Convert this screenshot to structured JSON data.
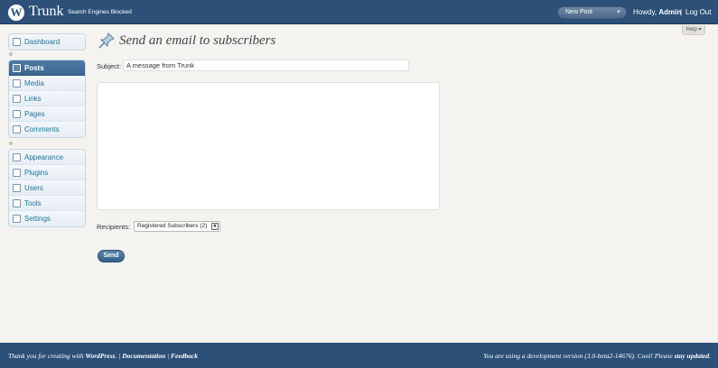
{
  "header": {
    "logo_glyph": "W",
    "site_title": "Trunk",
    "site_subtitle": "Search Engines Blocked",
    "new_post_label": "New Post",
    "new_post_arrow": "▼",
    "howdy_prefix": "Howdy, ",
    "username": "Admin",
    "separator": "|",
    "logout_label": "Log Out",
    "help_label": "Help ▾"
  },
  "sidebar": {
    "group1": [
      {
        "label": "Dashboard",
        "icon": "dashboard-icon"
      }
    ],
    "group2": [
      {
        "label": "Posts",
        "icon": "posts-icon",
        "current": true
      },
      {
        "label": "Media",
        "icon": "media-icon"
      },
      {
        "label": "Links",
        "icon": "links-icon"
      },
      {
        "label": "Pages",
        "icon": "pages-icon"
      },
      {
        "label": "Comments",
        "icon": "comments-icon"
      }
    ],
    "group3": [
      {
        "label": "Appearance",
        "icon": "appearance-icon"
      },
      {
        "label": "Plugins",
        "icon": "plugins-icon"
      },
      {
        "label": "Users",
        "icon": "users-icon"
      },
      {
        "label": "Tools",
        "icon": "tools-icon"
      },
      {
        "label": "Settings",
        "icon": "settings-icon"
      }
    ]
  },
  "main": {
    "title": "Send an email to subscribers",
    "title_icon": "pushpin-icon",
    "subject_label": "Subject:",
    "subject_value": "A message from Trunk",
    "body_value": "",
    "recipients_label": "Recipients:",
    "recipients_selected": "Registered Subscribers (2)",
    "recipients_arrow": "▼",
    "send_label": "Send"
  },
  "footer": {
    "left_prefix": "Thank you for creating with ",
    "wordpress_link": "WordPress",
    "left_sep1": ". | ",
    "documentation_link": "Documentation",
    "left_sep2": " | ",
    "feedback_link": "Feedback",
    "right_prefix": "You are using a development version (3.0-beta2-14676). Cool! Please ",
    "stay_updated_link": "stay updated",
    "right_suffix": "."
  },
  "colors": {
    "header_bg": "#2c5078",
    "accent": "#21759b",
    "page_bg": "#f5f3ef"
  }
}
